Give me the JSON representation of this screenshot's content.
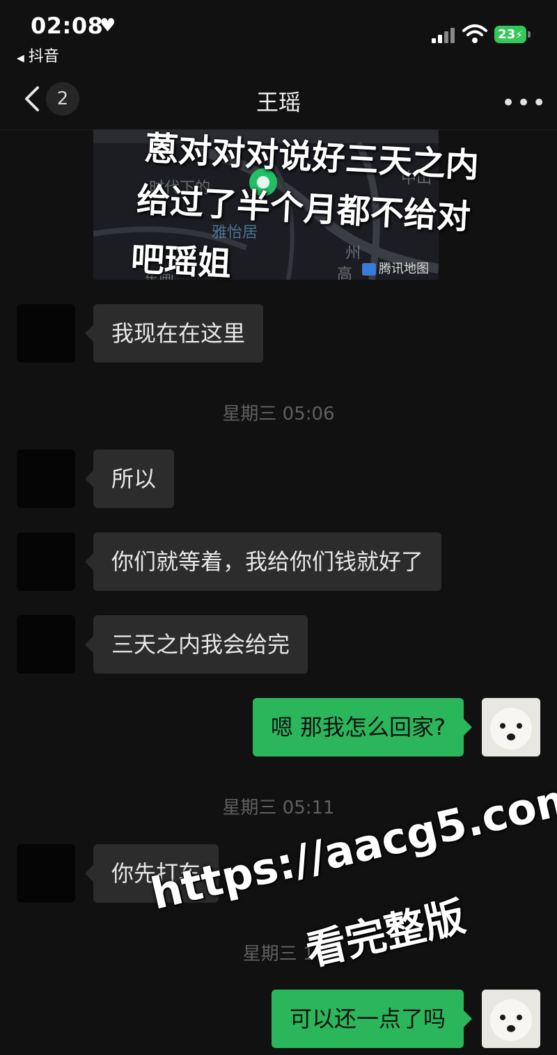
{
  "status_bar": {
    "time": "02:08",
    "back_app": "抖音",
    "battery": "23"
  },
  "header": {
    "unread_count": "2",
    "title": "王瑶"
  },
  "location_card": {
    "labels": [
      "时代下的",
      "中山",
      "雅怡居",
      "东画",
      "高",
      "州"
    ],
    "brand": "腾讯地图"
  },
  "caption": {
    "line1": "蒽对对对说好三天之内",
    "line2": "给过了半个月都不给对",
    "line3": "吧瑶姐"
  },
  "messages": [
    {
      "side": "in",
      "text": "我现在在这里"
    },
    {
      "type": "time",
      "text": "星期三 05:06"
    },
    {
      "side": "in",
      "text": "所以"
    },
    {
      "side": "in",
      "text": "你们就等着，我给你们钱就好了"
    },
    {
      "side": "in",
      "text": "三天之内我会给完"
    },
    {
      "side": "out",
      "text": "嗯 那我怎么回家?"
    },
    {
      "type": "time",
      "text": "星期三 05:11"
    },
    {
      "side": "in",
      "text": "你先打车"
    },
    {
      "type": "time",
      "text": "星期三 1"
    },
    {
      "side": "out",
      "text": "可以还一点了吗"
    }
  ],
  "watermark": {
    "url": "https://aacg5.com",
    "text": "看完整版"
  },
  "colors": {
    "background": "#111111",
    "incoming_bubble": "#2c2c2c",
    "outgoing_bubble": "#2cb65c",
    "battery": "#34c759"
  }
}
